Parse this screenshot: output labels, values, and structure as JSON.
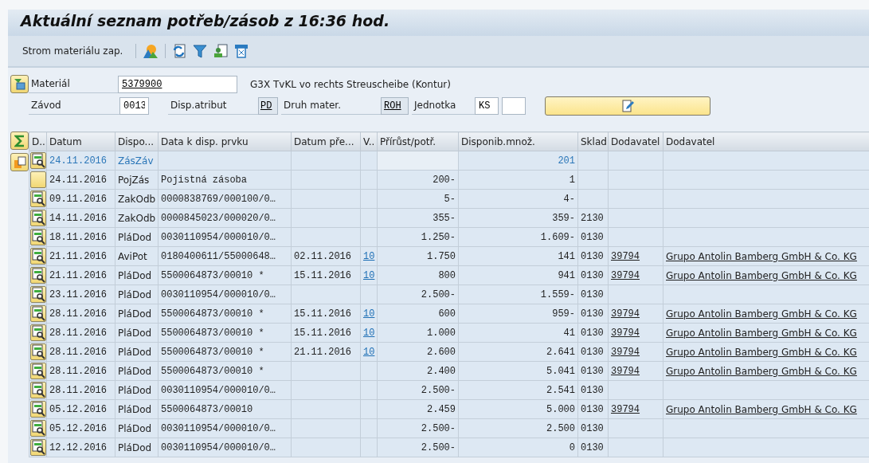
{
  "window": {
    "title": "Aktuální seznam potřeb/zásob z 16:36 hod."
  },
  "toolbar": {
    "label": "Strom materiálu zap."
  },
  "form": {
    "material": {
      "label": "Materiál",
      "value": "5379900",
      "description": "G3X TvKL vo rechts Streuscheibe (Kontur)"
    },
    "plant": {
      "label": "Závod",
      "value": "0013"
    },
    "mrp_attr": {
      "label": "Disp.atribut",
      "value": "PD"
    },
    "material_type": {
      "label": "Druh mater.",
      "value": "ROH"
    },
    "unit": {
      "label": "Jednotka",
      "value": "KS"
    }
  },
  "table": {
    "columns": [
      "D..",
      "Datum",
      "Dispo...",
      "Data k disp. prvku",
      "Datum pře...",
      "V..",
      "Přírůst/potř.",
      "Disponib.množ.",
      "Sklad",
      "Dodavatel",
      "Dodavatel"
    ],
    "rows": [
      {
        "kind": "total",
        "date": "24.11.2016",
        "element": "ZásZáv",
        "available": "201"
      },
      {
        "kind": "note",
        "date": "24.11.2016",
        "element": "PojZás",
        "data": "Pojistná zásoba",
        "qty": "200-",
        "available": "1"
      },
      {
        "kind": "item",
        "date": "09.11.2016",
        "element": "ZakOdb",
        "data": "0000838769/000100/0…",
        "qty": "5-",
        "available": "4-"
      },
      {
        "kind": "item",
        "date": "14.11.2016",
        "element": "ZakOdb",
        "data": "0000845023/000020/0…",
        "qty": "355-",
        "available": "359-",
        "storage": "2130"
      },
      {
        "kind": "item",
        "date": "18.11.2016",
        "element": "PláDod",
        "data": "0030110954/000010/0…",
        "qty": "1.250-",
        "available": "1.609-",
        "storage": "0130"
      },
      {
        "kind": "item",
        "date": "21.11.2016",
        "element": "AviPot",
        "data": "0180400611/55000648…",
        "resched": "02.11.2016",
        "v": "10",
        "qty": "1.750",
        "available": "141",
        "storage": "0130",
        "vendor": "39794",
        "vendor_name": "Grupo Antolin Bamberg GmbH & Co. KG"
      },
      {
        "kind": "item",
        "date": "21.11.2016",
        "element": "PláDod",
        "data": "5500064873/00010 *",
        "resched": "15.11.2016",
        "v": "10",
        "qty": "800",
        "available": "941",
        "storage": "0130",
        "vendor": "39794",
        "vendor_name": "Grupo Antolin Bamberg GmbH & Co. KG"
      },
      {
        "kind": "item",
        "date": "23.11.2016",
        "element": "PláDod",
        "data": "0030110954/000010/0…",
        "qty": "2.500-",
        "available": "1.559-",
        "storage": "0130"
      },
      {
        "kind": "item",
        "date": "28.11.2016",
        "element": "PláDod",
        "data": "5500064873/00010 *",
        "resched": "15.11.2016",
        "v": "10",
        "qty": "600",
        "available": "959-",
        "storage": "0130",
        "vendor": "39794",
        "vendor_name": "Grupo Antolin Bamberg GmbH & Co. KG"
      },
      {
        "kind": "item",
        "date": "28.11.2016",
        "element": "PláDod",
        "data": "5500064873/00010 *",
        "resched": "15.11.2016",
        "v": "10",
        "qty": "1.000",
        "available": "41",
        "storage": "0130",
        "vendor": "39794",
        "vendor_name": "Grupo Antolin Bamberg GmbH & Co. KG"
      },
      {
        "kind": "item",
        "date": "28.11.2016",
        "element": "PláDod",
        "data": "5500064873/00010 *",
        "resched": "21.11.2016",
        "v": "10",
        "qty": "2.600",
        "available": "2.641",
        "storage": "0130",
        "vendor": "39794",
        "vendor_name": "Grupo Antolin Bamberg GmbH & Co. KG"
      },
      {
        "kind": "item",
        "date": "28.11.2016",
        "element": "PláDod",
        "data": "5500064873/00010 *",
        "qty": "2.400",
        "available": "5.041",
        "storage": "0130",
        "vendor": "39794",
        "vendor_name": "Grupo Antolin Bamberg GmbH & Co. KG"
      },
      {
        "kind": "item",
        "date": "28.11.2016",
        "element": "PláDod",
        "data": "0030110954/000010/0…",
        "qty": "2.500-",
        "available": "2.541",
        "storage": "0130"
      },
      {
        "kind": "item",
        "date": "05.12.2016",
        "element": "PláDod",
        "data": "5500064873/00010",
        "qty": "2.459",
        "available": "5.000",
        "storage": "0130",
        "vendor": "39794",
        "vendor_name": "Grupo Antolin Bamberg GmbH & Co. KG"
      },
      {
        "kind": "item",
        "date": "05.12.2016",
        "element": "PláDod",
        "data": "0030110954/000010/0…",
        "qty": "2.500-",
        "available": "2.500",
        "storage": "0130"
      },
      {
        "kind": "item",
        "date": "12.12.2016",
        "element": "PláDod",
        "data": "0030110954/000010/0…",
        "qty": "2.500-",
        "available": "0",
        "storage": "0130"
      }
    ]
  }
}
